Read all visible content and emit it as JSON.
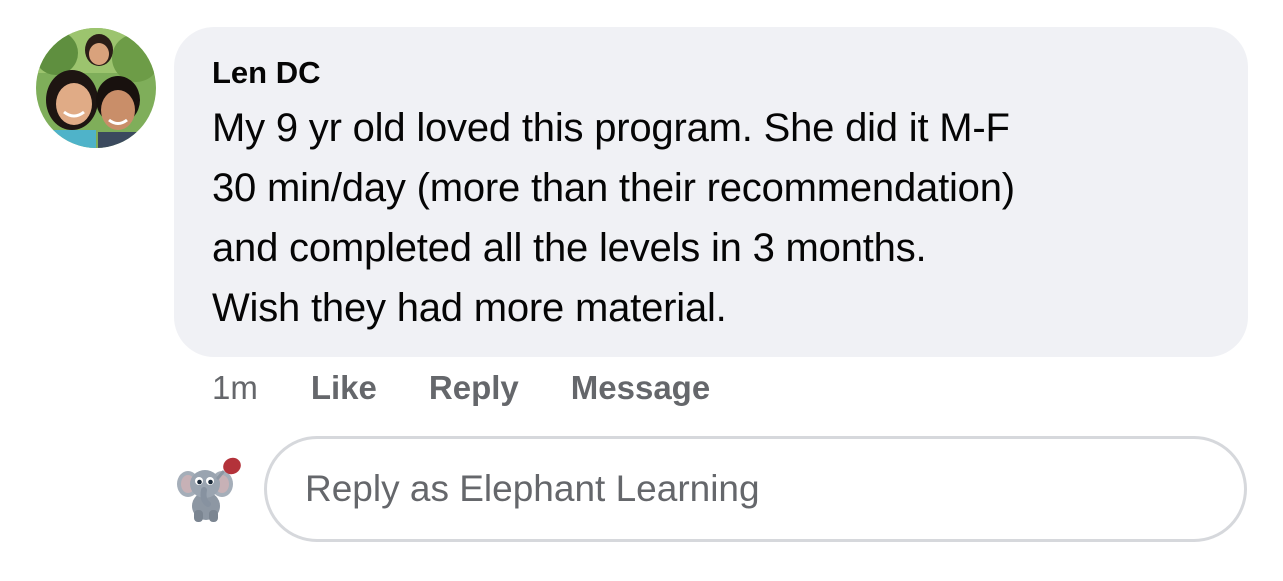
{
  "comment": {
    "author": "Len DC",
    "text": "My 9 yr old loved this program. She did it M-F\n30 min/day (more than their recommendation)\nand completed all the levels in 3 months.\nWish they had more material.",
    "avatar_icon": "family-photo-avatar"
  },
  "actions": {
    "time": "1m",
    "like_label": "Like",
    "reply_label": "Reply",
    "message_label": "Message"
  },
  "reply": {
    "placeholder": "Reply as Elephant Learning",
    "value": "",
    "avatar_icon": "elephant-mascot-icon"
  },
  "colors": {
    "bubble_background": "#f0f1f5",
    "secondary_text": "#65676b",
    "primary_text": "#050505",
    "input_border": "#d6d8dc"
  }
}
